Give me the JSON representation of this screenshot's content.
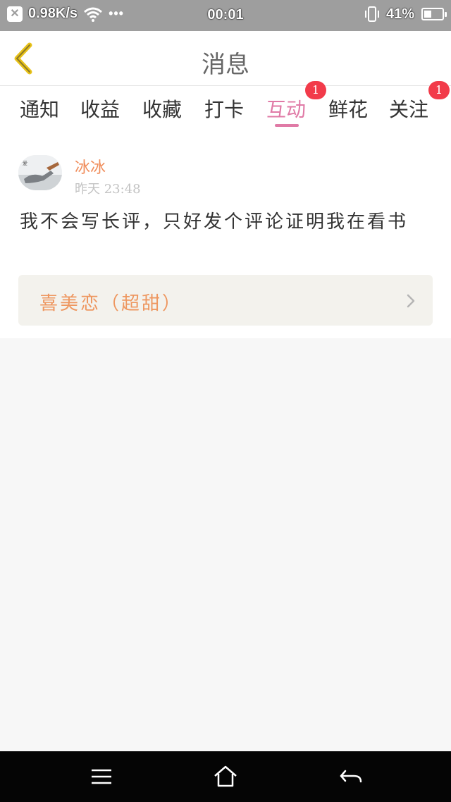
{
  "status_bar": {
    "close_icon": "close-icon",
    "network_speed": "0.98K/s",
    "wifi_icon": "wifi-icon",
    "more": "•••",
    "time": "00:01",
    "battery_percent": "41%",
    "battery_level": 0.41
  },
  "header": {
    "back_icon": "chevron-left-icon",
    "title": "消息"
  },
  "tabs": [
    {
      "label": "通知"
    },
    {
      "label": "收益"
    },
    {
      "label": "收藏"
    },
    {
      "label": "打卡"
    },
    {
      "label": "互动",
      "active": true,
      "badge": "1"
    },
    {
      "label": "鲜花"
    },
    {
      "label": "关注",
      "badge": "1"
    }
  ],
  "message": {
    "username": "冰冰",
    "timestamp": "昨天 23:48",
    "content": "我不会写长评，只好发个评论证明我在看书",
    "book_title": "喜美恋（超甜）"
  },
  "colors": {
    "accent_pink": "#e07aa6",
    "username_orange": "#f08c5a",
    "badge_red": "#f23b4a",
    "back_icon_yellow": "#e8c21a"
  },
  "nav_bar": {
    "menu_icon": "menu-icon",
    "home_icon": "home-icon",
    "back_icon": "return-icon"
  }
}
